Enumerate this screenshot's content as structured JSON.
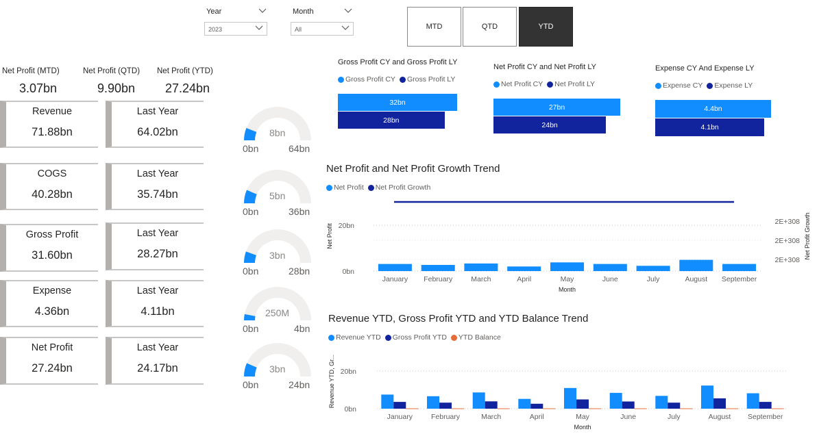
{
  "colors": {
    "primary": "#118dff",
    "secondary": "#12239e",
    "tertiary": "#e66c37",
    "gauge_track": "#f0efee",
    "active_button": "#333333"
  },
  "slicers": {
    "year": {
      "title": "Year",
      "value": "2023"
    },
    "month": {
      "title": "Month",
      "value": "All"
    }
  },
  "period_buttons": [
    {
      "label": "MTD",
      "active": false
    },
    {
      "label": "QTD",
      "active": false
    },
    {
      "label": "YTD",
      "active": true
    }
  ],
  "kpis": [
    {
      "label": "Net Profit (MTD)",
      "value": "3.07bn"
    },
    {
      "label": "Net Profit (QTD)",
      "value": "9.90bn"
    },
    {
      "label": "Net Profit (YTD)",
      "value": "27.24bn"
    }
  ],
  "cards": [
    {
      "title": "Revenue",
      "value": "71.88bn",
      "ly_title": "Last Year",
      "ly_value": "64.02bn"
    },
    {
      "title": "COGS",
      "value": "40.28bn",
      "ly_title": "Last Year",
      "ly_value": "35.74bn"
    },
    {
      "title": "Gross Profit",
      "value": "31.60bn",
      "ly_title": "Last Year",
      "ly_value": "28.27bn"
    },
    {
      "title": "Expense",
      "value": "4.36bn",
      "ly_title": "Last Year",
      "ly_value": "4.11bn"
    },
    {
      "title": "Net Profit",
      "value": "27.24bn",
      "ly_title": "Last Year",
      "ly_value": "24.17bn"
    }
  ],
  "gauges": [
    {
      "min": "0bn",
      "max": "64bn",
      "value": "8bn",
      "fill_fraction": 0.12
    },
    {
      "min": "0bn",
      "max": "36bn",
      "value": "5bn",
      "fill_fraction": 0.13
    },
    {
      "min": "0bn",
      "max": "28bn",
      "value": "3bn",
      "fill_fraction": 0.11
    },
    {
      "min": "0bn",
      "max": "4bn",
      "value": "250M",
      "fill_fraction": 0.06
    },
    {
      "min": "0bn",
      "max": "24bn",
      "value": "3bn",
      "fill_fraction": 0.13
    }
  ],
  "comparisons": [
    {
      "title": "Gross Profit CY and Gross Profit LY",
      "cy_legend": "Gross Profit CY",
      "ly_legend": "Gross Profit LY",
      "cy_label": "32bn",
      "ly_label": "28bn",
      "cy": 31.6,
      "ly": 28.27
    },
    {
      "title": "Net Profit CY and Net Profit LY",
      "cy_legend": "Net Profit CY",
      "ly_legend": "Net Profit LY",
      "cy_label": "27bn",
      "ly_label": "24bn",
      "cy": 27.24,
      "ly": 24.17
    },
    {
      "title": "Expense CY And Expense LY",
      "cy_legend": "Expense CY",
      "ly_legend": "Expense LY",
      "cy_label": "4.4bn",
      "ly_label": "4.1bn",
      "cy": 4.36,
      "ly": 4.11
    }
  ],
  "chart_data": [
    {
      "type": "bar",
      "title": "Net Profit and Net Profit Growth Trend",
      "xlabel": "Month",
      "ylabel": "Net Profit",
      "y2label": "Net Profit Growth",
      "categories": [
        "January",
        "February",
        "March",
        "April",
        "May",
        "June",
        "July",
        "August",
        "September"
      ],
      "series": [
        {
          "name": "Net Profit",
          "values": [
            3.1,
            2.7,
            3.3,
            2.0,
            3.8,
            3.1,
            2.3,
            4.9,
            3.1
          ]
        },
        {
          "name": "Net Profit Growth",
          "kind": "line"
        }
      ],
      "ylim": [
        0,
        20
      ],
      "yticks": [
        "0bn",
        "20bn"
      ],
      "y2ticks": [
        "2E+308",
        "2E+308",
        "2E+308"
      ],
      "grid": true,
      "legend": "top-left"
    },
    {
      "type": "bar",
      "title": "Revenue YTD, Gross Profit YTD and YTD Balance Trend",
      "xlabel": "Month",
      "ylabel": "Revenue YTD, Gr...",
      "categories": [
        "January",
        "February",
        "March",
        "April",
        "May",
        "June",
        "July",
        "August",
        "September"
      ],
      "series": [
        {
          "name": "Revenue YTD",
          "values": [
            7.5,
            6.6,
            8.6,
            5.2,
            11.0,
            8.4,
            6.8,
            12.3,
            8.2
          ]
        },
        {
          "name": "Gross Profit YTD",
          "values": [
            3.6,
            3.2,
            3.9,
            2.6,
            4.9,
            3.8,
            3.2,
            5.5,
            3.6
          ]
        },
        {
          "name": "YTD Balance",
          "values": [
            0.2,
            0.2,
            0.2,
            0.2,
            0.2,
            0.2,
            0.2,
            0.2,
            0.2
          ]
        }
      ],
      "ylim": [
        0,
        20
      ],
      "yticks": [
        "0bn",
        "20bn"
      ],
      "grid": true,
      "legend": "top-left"
    }
  ]
}
